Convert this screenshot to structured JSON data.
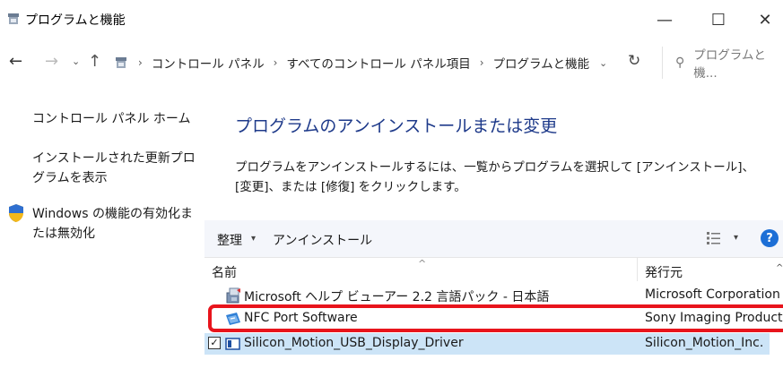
{
  "window": {
    "title": "プログラムと機能",
    "minimize": "—",
    "maximize": "☐",
    "close": "✕"
  },
  "nav": {
    "back": "←",
    "forward": "→",
    "recent": "⌄",
    "up": "↑",
    "breadcrumb": [
      "コントロール パネル",
      "すべてのコントロール パネル項目",
      "プログラムと機能"
    ],
    "separator": "›",
    "address_dropdown": "⌄",
    "refresh": "↻",
    "search_placeholder": "プログラムと機...",
    "search_icon": "⚲"
  },
  "sidebar": {
    "home": "コントロール パネル ホーム",
    "installed_updates": "インストールされた更新プログラムを表示",
    "windows_features": "Windows の機能の有効化または無効化"
  },
  "main": {
    "title": "プログラムのアンインストールまたは変更",
    "description": "プログラムをアンインストールするには、一覧からプログラムを選択して [アンインストール]、[変更]、または [修復] をクリックします。"
  },
  "toolbar": {
    "organize": "整理",
    "organize_dropdown": "▾",
    "uninstall": "アンインストール",
    "view_dropdown": "▾",
    "help": "?"
  },
  "list": {
    "headers": {
      "name": "名前",
      "publisher": "発行元",
      "sort_caret": "^",
      "right_caret": "^"
    },
    "rows": [
      {
        "name": "Microsoft ヘルプ ビューアー 2.2 言語パック - 日本語",
        "publisher": "Microsoft Corporation",
        "icon": "installer-package-icon",
        "selected": false,
        "checked": false
      },
      {
        "name": "NFC Port Software",
        "publisher": "Sony Imaging Products &",
        "icon": "nfc-port-icon",
        "selected": false,
        "checked": false
      },
      {
        "name": "Silicon_Motion_USB_Display_Driver",
        "publisher": "Silicon_Motion_Inc.",
        "icon": "display-driver-icon",
        "selected": true,
        "checked": true,
        "check_mark": "✓"
      }
    ]
  },
  "colors": {
    "link_title": "#1e3a8a",
    "selection": "#cce4f7",
    "highlight_border": "#e8141c",
    "help_blue": "#1d6fd6"
  }
}
